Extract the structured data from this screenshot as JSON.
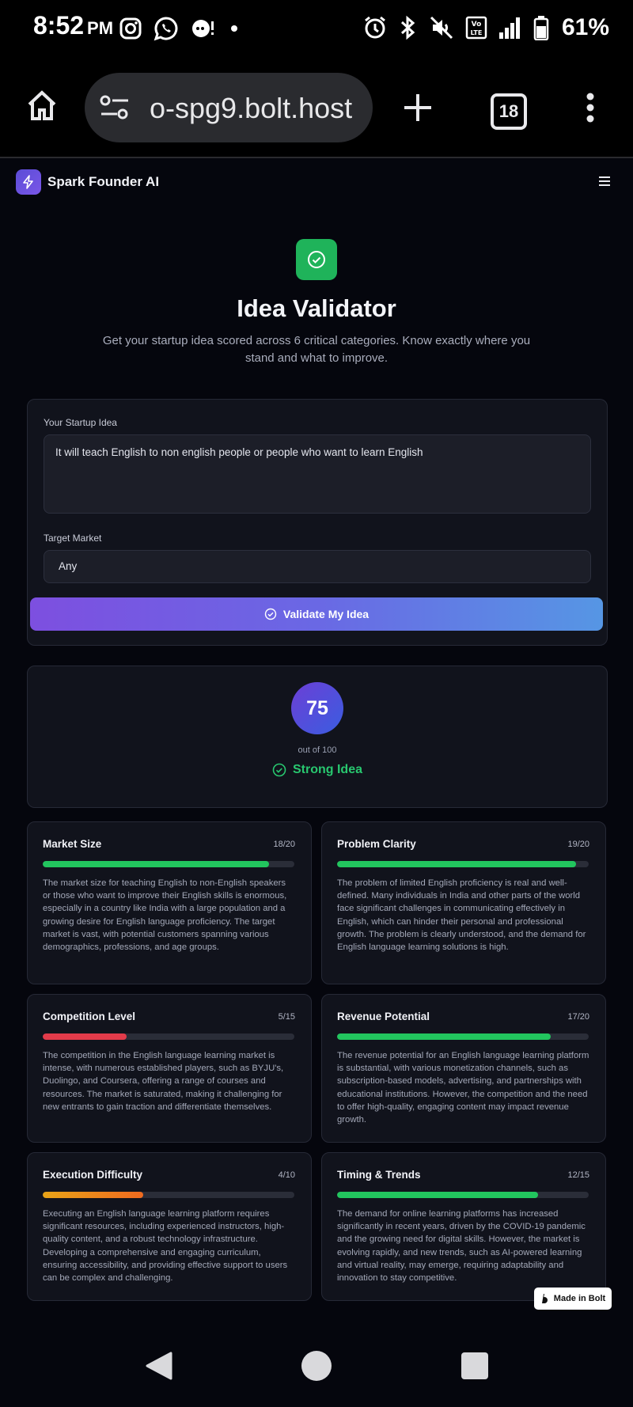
{
  "status_bar": {
    "time": "8:52",
    "ampm": "PM",
    "battery": "61%"
  },
  "browser": {
    "url": "o-spg9.bolt.host",
    "tab_count": "18"
  },
  "app": {
    "name": "Spark Founder AI"
  },
  "hero": {
    "title": "Idea Validator",
    "subtitle": "Get your startup idea scored across 6 critical categories. Know exactly where you stand and what to improve."
  },
  "form": {
    "idea_label": "Your Startup Idea",
    "idea_value": "It will teach English to non english people or people who want to learn English",
    "market_label": "Target Market",
    "market_value": "Any",
    "button_label": "Validate My Idea"
  },
  "score": {
    "value": "75",
    "out_of": "out of 100",
    "verdict": "Strong Idea"
  },
  "categories": [
    {
      "name": "Market Size",
      "score": "18/20",
      "fraction": 0.9,
      "color": "#22c55e",
      "desc": "The market size for teaching English to non-English speakers or those who want to improve their English skills is enormous, especially in a country like India with a large population and a growing desire for English language proficiency. The target market is vast, with potential customers spanning various demographics, professions, and age groups."
    },
    {
      "name": "Problem Clarity",
      "score": "19/20",
      "fraction": 0.95,
      "color": "#22c55e",
      "desc": "The problem of limited English proficiency is real and well-defined. Many individuals in India and other parts of the world face significant challenges in communicating effectively in English, which can hinder their personal and professional growth. The problem is clearly understood, and the demand for English language learning solutions is high."
    },
    {
      "name": "Competition Level",
      "score": "5/15",
      "fraction": 0.3333,
      "color": "#e23b4a",
      "desc": "The competition in the English language learning market is intense, with numerous established players, such as BYJU's, Duolingo, and Coursera, offering a range of courses and resources. The market is saturated, making it challenging for new entrants to gain traction and differentiate themselves."
    },
    {
      "name": "Revenue Potential",
      "score": "17/20",
      "fraction": 0.85,
      "color": "#22c55e",
      "desc": "The revenue potential for an English language learning platform is substantial, with various monetization channels, such as subscription-based models, advertising, and partnerships with educational institutions. However, the competition and the need to offer high-quality, engaging content may impact revenue growth."
    },
    {
      "name": "Execution Difficulty",
      "score": "4/10",
      "fraction": 0.4,
      "color": "#e8a317",
      "desc": "Executing an English language learning platform requires significant resources, including experienced instructors, high-quality content, and a robust technology infrastructure. Developing a comprehensive and engaging curriculum, ensuring accessibility, and providing effective support to users can be complex and challenging."
    },
    {
      "name": "Timing & Trends",
      "score": "12/15",
      "fraction": 0.8,
      "color": "#22c55e",
      "desc": "The demand for online learning platforms has increased significantly in recent years, driven by the COVID-19 pandemic and the growing need for digital skills. However, the market is evolving rapidly, and new trends, such as AI-powered learning and virtual reality, may emerge, requiring adaptability and innovation to stay competitive."
    }
  ],
  "badge": {
    "label": "Made in Bolt"
  }
}
